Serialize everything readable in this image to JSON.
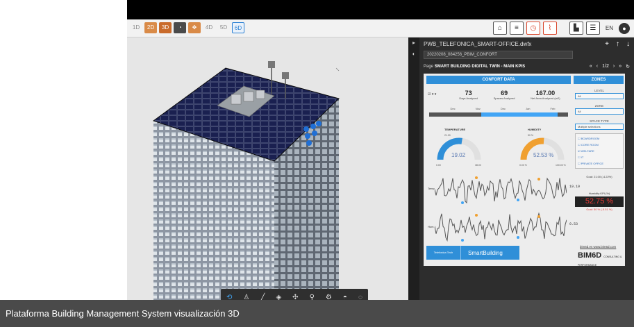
{
  "toolbar": {
    "modes": [
      "1D",
      "2D",
      "3D",
      "4D",
      "5D",
      "6D"
    ],
    "language": "EN"
  },
  "panel": {
    "file_name": "PWB_TELEFONICA_SMART-OFFICE.dwfx",
    "report_selector": "20220208_084256_PBIM_CONFORT",
    "page_label": "Page",
    "page_title": "SMART BUILDING DIGITAL TWIN - MAIN KPIS",
    "pager": "1/2"
  },
  "report": {
    "confort_header": "CONFORT DATA",
    "zones_header": "ZONES",
    "kpis": [
      {
        "value": "73",
        "label": "Days Analyzed"
      },
      {
        "value": "69",
        "label": "Spaces Analyzed"
      },
      {
        "value": "167.00",
        "label": "Net Area Analyzed (m2)"
      }
    ],
    "months": [
      "Dec",
      "Nov",
      "Dec",
      "Jan",
      "Feb"
    ],
    "temperature": {
      "title": "TEMPERATURE",
      "value": "19.02",
      "fraction": 0.55,
      "min": "0.00",
      "max": "38.00",
      "top": "21.00"
    },
    "humidity": {
      "title": "HUMIDITY",
      "value": "52.53 %",
      "fraction": 0.5253,
      "min": "0.00 %",
      "max": "100.00 %",
      "top": "50 %"
    },
    "temp_series_label": "Temp.",
    "temp_series_value": "19.19",
    "hum_series_label": "Hum.",
    "hum_series_value": "0.53",
    "zone_level_label": "LEVEL",
    "zone_level_value": "All",
    "zone_zone_label": "ZONE",
    "zone_zone_value": "All",
    "zone_space_label": "SPACE TYPE",
    "zone_space_value": "Multiple selections",
    "space_types": [
      "BOARDROOM",
      "CORE ROOM",
      "WELFARE",
      "IT",
      "PRIVATE OFFICE"
    ],
    "goal_temp": "Goal: 21.00 (-4.22%)",
    "humidity_kpi_title": "Humidity KPI (%)",
    "humidity_kpi_value": "52.75 %",
    "humidity_kpi_goal": "Goal: 50 % (-5.51 %)",
    "brand_left": "Telefonica Tech",
    "brand_right": "SmartBuilding",
    "sites": "bim6d.es  www.bim6d.com",
    "bim6d_logo": "BIM6D",
    "bim6d_sub": "CONSULTING & PERFORMANCE"
  },
  "caption": "Plataforma Building Management System visualización 3D",
  "colors": {
    "accent": "#2f8fd8",
    "orange": "#f0a030",
    "red": "#e53935"
  }
}
